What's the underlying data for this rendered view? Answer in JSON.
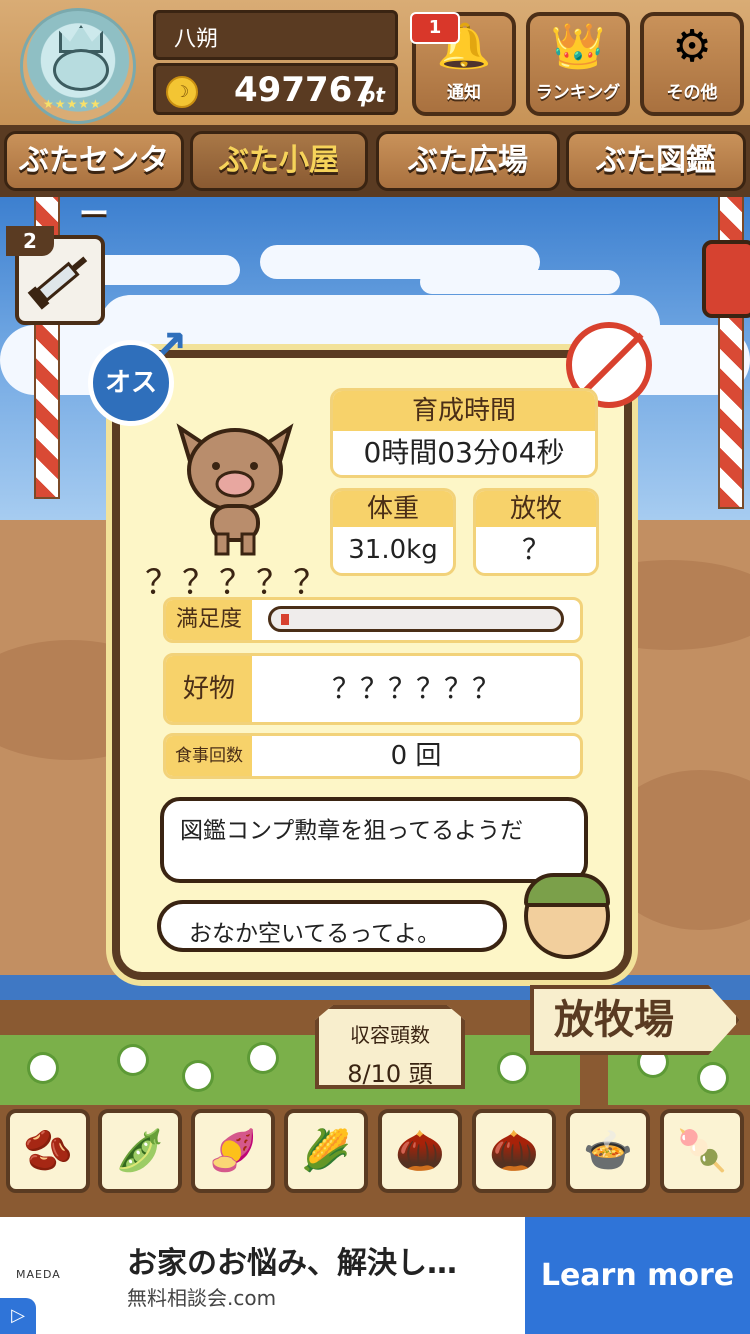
{
  "header": {
    "player_name": "八朔",
    "points": "497767",
    "points_unit": "pt",
    "notification_count": "1",
    "buttons": [
      {
        "label": "通知",
        "icon": "bell-icon"
      },
      {
        "label": "ランキング",
        "icon": "crown-icon"
      },
      {
        "label": "その他",
        "icon": "gear-icon"
      }
    ]
  },
  "tabs": [
    {
      "label": "ぶたセンター",
      "active": false
    },
    {
      "label": "ぶた小屋",
      "active": true
    },
    {
      "label": "ぶた広場",
      "active": false
    },
    {
      "label": "ぶた図鑑",
      "active": false
    }
  ],
  "injection_count": "2",
  "pig": {
    "gender_label": "オス",
    "name": "？？？？？",
    "growth_time_label": "育成時間",
    "growth_time": "0時間03分04秒",
    "weight_label": "体重",
    "weight": "31.0kg",
    "grazing_label": "放牧",
    "grazing": "？",
    "satisfaction_label": "満足度",
    "satisfaction_fraction": 0.03,
    "favorite_label": "好物",
    "favorite": "？？？？？？",
    "meals_label": "食事回数",
    "meals": "0 回"
  },
  "dialogue": {
    "speech_1": "図鑑コンプ勲章を狙ってるようだ",
    "speech_2": "おなか空いてるってよ。"
  },
  "capacity": {
    "label": "収容頭数",
    "value": "8/10 頭"
  },
  "pasture_sign": "放牧場",
  "foods": [
    {
      "icon": "soybeans-icon",
      "glyph": "🫘"
    },
    {
      "icon": "mixed-beans-icon",
      "glyph": "🫛"
    },
    {
      "icon": "sweet-potato-icon",
      "glyph": "🍠"
    },
    {
      "icon": "corn-icon",
      "glyph": "🌽"
    },
    {
      "icon": "nuts-leaf-icon",
      "glyph": "🌰"
    },
    {
      "icon": "acorn-icon",
      "glyph": "🌰"
    },
    {
      "icon": "bean-plate-icon",
      "glyph": "🍲"
    },
    {
      "icon": "meatball-plate-icon",
      "glyph": "🍡"
    }
  ],
  "ad": {
    "brand": "MAEDA",
    "title": "お家のお悩み、解決し…",
    "subtitle": "無料相談会.com",
    "button": "Learn more"
  },
  "colors": {
    "accent_blue": "#2f74d8",
    "wood": "#5a3b22",
    "panel": "#fdf6c7",
    "header_label": "#f7d26a"
  }
}
